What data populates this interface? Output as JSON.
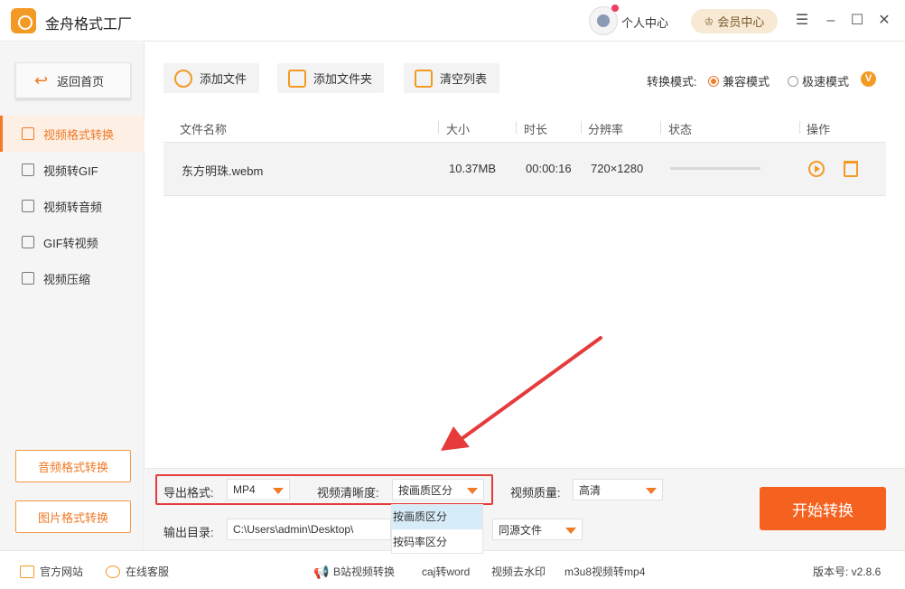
{
  "app": {
    "title": "金舟格式工厂",
    "user_center": "个人中心",
    "vip_center": "会员中心"
  },
  "sidebar": {
    "home": "返回首页",
    "items": [
      {
        "label": "视频格式转换",
        "active": true
      },
      {
        "label": "视频转GIF",
        "active": false
      },
      {
        "label": "视频转音频",
        "active": false
      },
      {
        "label": "GIF转视频",
        "active": false
      },
      {
        "label": "视频压缩",
        "active": false
      }
    ],
    "audio_convert": "音频格式转换",
    "image_convert": "图片格式转换"
  },
  "toolbar": {
    "add_file": "添加文件",
    "add_folder": "添加文件夹",
    "clear_list": "清空列表",
    "mode_label": "转换模式:",
    "mode_compat": "兼容模式",
    "mode_fast": "极速模式",
    "vip_badge": "V"
  },
  "table": {
    "columns": [
      "文件名称",
      "大小",
      "时长",
      "分辨率",
      "状态",
      "操作"
    ],
    "rows": [
      {
        "name": "东方明珠.webm",
        "size": "10.37MB",
        "duration": "00:00:16",
        "resolution": "720×1280",
        "progress": 0
      }
    ]
  },
  "settings": {
    "export_format_label": "导出格式:",
    "export_format_value": "MP4",
    "clarity_label": "视频清晰度:",
    "clarity_value": "按画质区分",
    "clarity_options": [
      "按画质区分",
      "按码率区分"
    ],
    "quality_label": "视频质量:",
    "quality_value": "高清",
    "output_dir_label": "输出目录:",
    "output_dir_value": "C:\\Users\\admin\\Desktop\\",
    "output_file_value": "同源文件",
    "start_button": "开始转换"
  },
  "statusbar": {
    "website": "官方网站",
    "service": "在线客服",
    "links": [
      "B站视频转换",
      "caj转word",
      "视频去水印",
      "m3u8视频转mp4"
    ],
    "version": "版本号: v2.8.6"
  },
  "colors": {
    "accent": "#f07a26",
    "start_button": "#f5621f",
    "highlight_red": "#e63b3b"
  }
}
